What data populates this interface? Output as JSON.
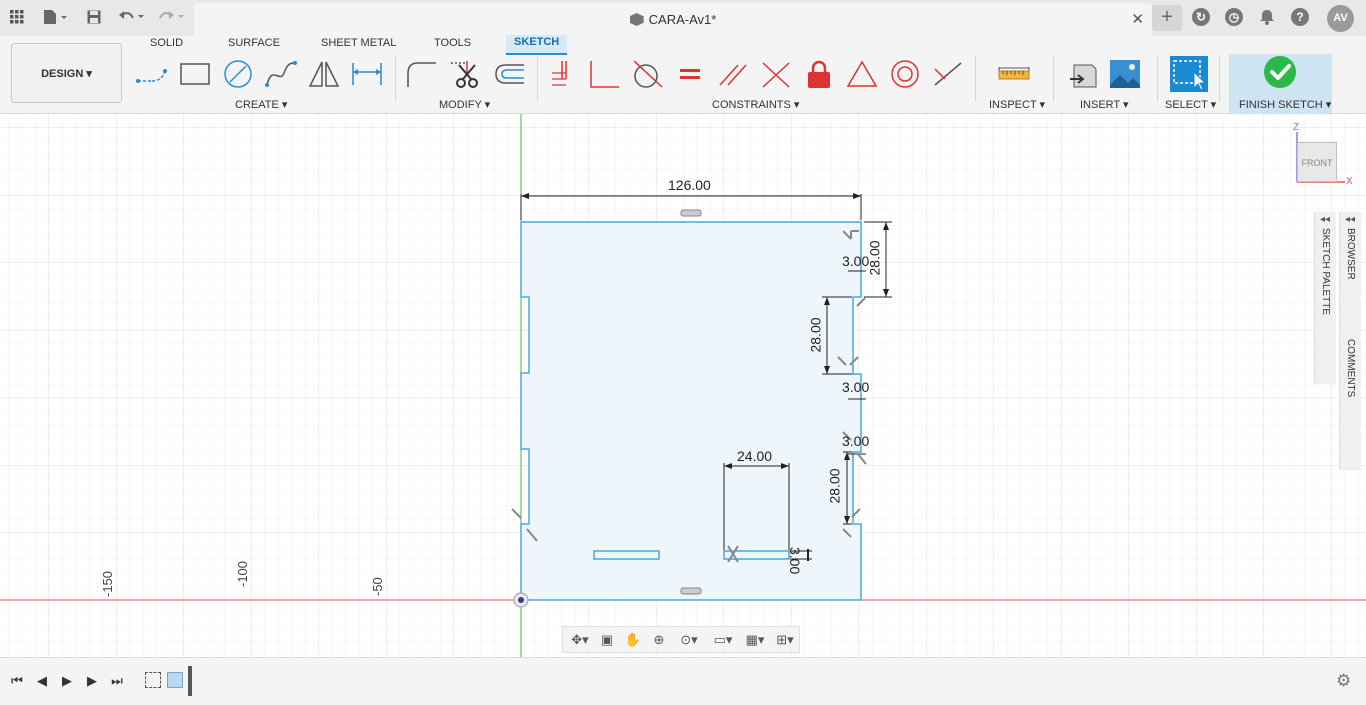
{
  "title_bar": {
    "grid_icon": "grid-icon",
    "file_icon": "file-icon",
    "save_icon": "save-icon",
    "undo_icon": "undo-icon",
    "redo_icon": "redo-icon",
    "document_title": "CARA-Av1*",
    "close_glyph": "✕",
    "new_tab_glyph": "+",
    "avatar_initials": "AV"
  },
  "toolbar": {
    "workspace_button": "DESIGN ▾",
    "tabs": [
      "SOLID",
      "SURFACE",
      "SHEET METAL",
      "TOOLS",
      "SKETCH"
    ],
    "active_tab": "SKETCH",
    "groups": {
      "create": "CREATE ▾",
      "modify": "MODIFY ▾",
      "constraints": "CONSTRAINTS ▾",
      "inspect": "INSPECT ▾",
      "insert": "INSERT ▾",
      "select": "SELECT ▾",
      "finish": "FINISH SKETCH ▾"
    }
  },
  "side_panels": {
    "sketch_palette": "SKETCH PALETTE",
    "browser": "BROWSER",
    "comments": "COMMENTS"
  },
  "viewcube": {
    "face_label": "FRONT",
    "z_label": "Z",
    "x_label": "X"
  },
  "canvas": {
    "axis_ticks": [
      "-150",
      "-100",
      "-50"
    ],
    "dimensions": {
      "width": "126.00",
      "right_top": "28.00",
      "right_top_small": "3.00",
      "right_middle": "28.00",
      "right_middle_small": "3.00",
      "right_lower_small": "3.00",
      "right_lower": "28.00",
      "slot_width": "24.00",
      "slot_height": "3.00"
    }
  },
  "colors": {
    "sketch_line": "#4aa8d8",
    "sketch_fill": "#eef6fc",
    "x_axis": "#e05a5a",
    "y_axis": "#4caf50",
    "accent": "#1b8ad3",
    "finish_green": "#2db84a"
  }
}
